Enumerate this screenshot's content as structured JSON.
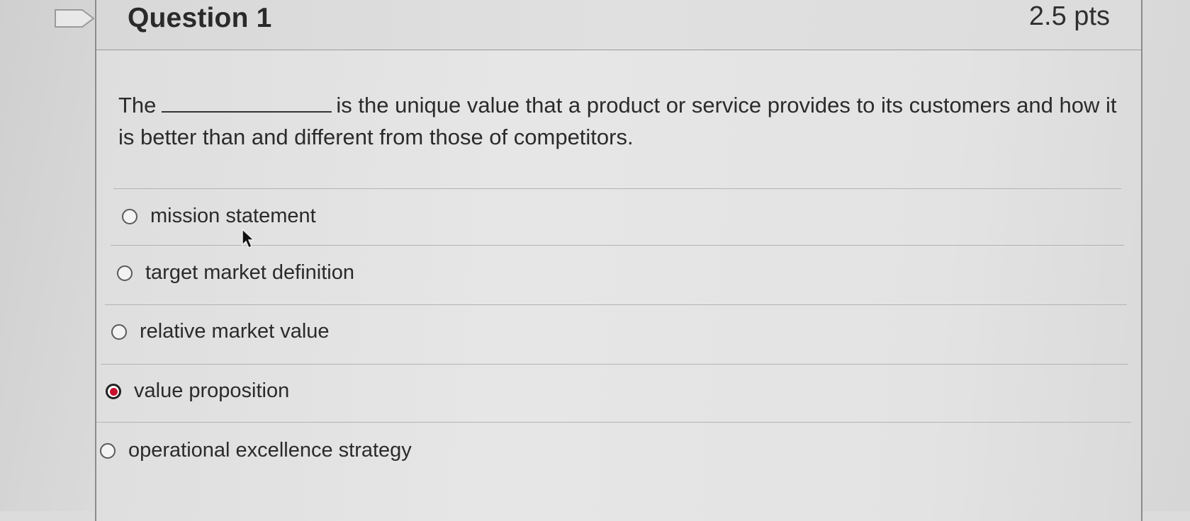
{
  "question": {
    "title": "Question 1",
    "points": "2.5 pts",
    "text_before_blank": "The",
    "text_after_blank": "is the unique value that a product or service provides to its customers and how it is better than and different from those of competitors."
  },
  "answers": [
    {
      "label": "mission statement",
      "selected": false
    },
    {
      "label": "target market definition",
      "selected": false
    },
    {
      "label": "relative market value",
      "selected": false
    },
    {
      "label": "value proposition",
      "selected": true
    },
    {
      "label": "operational excellence strategy",
      "selected": false
    }
  ],
  "colors": {
    "selected_radio": "#c8102e",
    "text": "#2b2b2b"
  },
  "icons": {
    "flag": "bookmark-flag-icon",
    "cursor": "mouse-pointer-icon"
  }
}
